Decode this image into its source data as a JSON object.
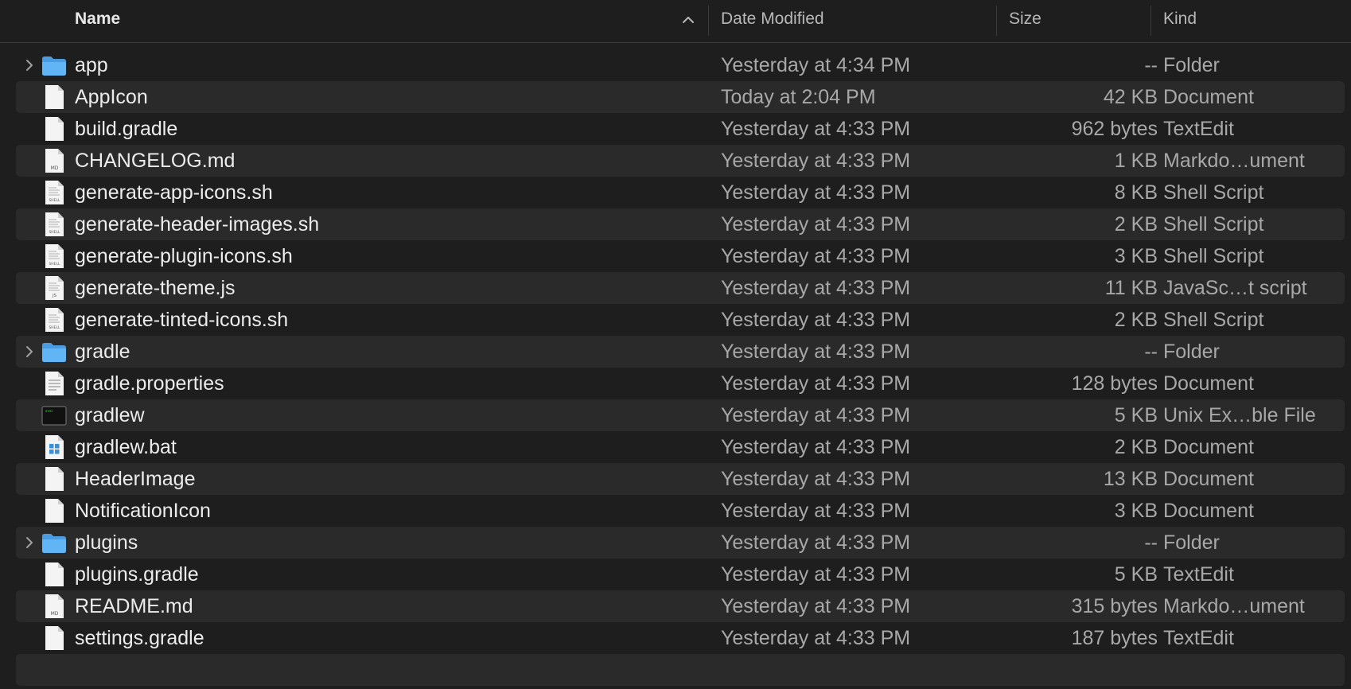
{
  "columns": {
    "name": "Name",
    "date": "Date Modified",
    "size": "Size",
    "kind": "Kind"
  },
  "sort": {
    "column": "name",
    "direction": "ascending",
    "icon": "chevron-up-icon"
  },
  "rows": [
    {
      "name": "app",
      "date": "Yesterday at 4:34 PM",
      "size": "--",
      "kind": "Folder",
      "icon": "folder",
      "expandable": true
    },
    {
      "name": "AppIcon",
      "date": "Today at 2:04 PM",
      "size": "42 KB",
      "kind": "Document",
      "icon": "doc"
    },
    {
      "name": "build.gradle",
      "date": "Yesterday at 4:33 PM",
      "size": "962 bytes",
      "kind": "TextEdit",
      "icon": "doc"
    },
    {
      "name": "CHANGELOG.md",
      "date": "Yesterday at 4:33 PM",
      "size": "1 KB",
      "kind": "Markdo…ument",
      "icon": "md"
    },
    {
      "name": "generate-app-icons.sh",
      "date": "Yesterday at 4:33 PM",
      "size": "8 KB",
      "kind": "Shell Script",
      "icon": "shell"
    },
    {
      "name": "generate-header-images.sh",
      "date": "Yesterday at 4:33 PM",
      "size": "2 KB",
      "kind": "Shell Script",
      "icon": "shell"
    },
    {
      "name": "generate-plugin-icons.sh",
      "date": "Yesterday at 4:33 PM",
      "size": "3 KB",
      "kind": "Shell Script",
      "icon": "shell"
    },
    {
      "name": "generate-theme.js",
      "date": "Yesterday at 4:33 PM",
      "size": "11 KB",
      "kind": "JavaSc…t script",
      "icon": "js"
    },
    {
      "name": "generate-tinted-icons.sh",
      "date": "Yesterday at 4:33 PM",
      "size": "2 KB",
      "kind": "Shell Script",
      "icon": "shell"
    },
    {
      "name": "gradle",
      "date": "Yesterday at 4:33 PM",
      "size": "--",
      "kind": "Folder",
      "icon": "folder",
      "expandable": true
    },
    {
      "name": "gradle.properties",
      "date": "Yesterday at 4:33 PM",
      "size": "128 bytes",
      "kind": "Document",
      "icon": "text"
    },
    {
      "name": "gradlew",
      "date": "Yesterday at 4:33 PM",
      "size": "5 KB",
      "kind": "Unix Ex…ble File",
      "icon": "exec"
    },
    {
      "name": "gradlew.bat",
      "date": "Yesterday at 4:33 PM",
      "size": "2 KB",
      "kind": "Document",
      "icon": "win"
    },
    {
      "name": "HeaderImage",
      "date": "Yesterday at 4:33 PM",
      "size": "13 KB",
      "kind": "Document",
      "icon": "doc"
    },
    {
      "name": "NotificationIcon",
      "date": "Yesterday at 4:33 PM",
      "size": "3 KB",
      "kind": "Document",
      "icon": "doc"
    },
    {
      "name": "plugins",
      "date": "Yesterday at 4:33 PM",
      "size": "--",
      "kind": "Folder",
      "icon": "folder",
      "expandable": true
    },
    {
      "name": "plugins.gradle",
      "date": "Yesterday at 4:33 PM",
      "size": "5 KB",
      "kind": "TextEdit",
      "icon": "doc"
    },
    {
      "name": "README.md",
      "date": "Yesterday at 4:33 PM",
      "size": "315 bytes",
      "kind": "Markdo…ument",
      "icon": "md"
    },
    {
      "name": "settings.gradle",
      "date": "Yesterday at 4:33 PM",
      "size": "187 bytes",
      "kind": "TextEdit",
      "icon": "doc"
    }
  ],
  "colors": {
    "background": "#1e1e1e",
    "stripe": "#2a2a2a",
    "folder": "#5aaef0",
    "text_primary": "#ececec",
    "text_secondary": "#a8a8a8"
  }
}
